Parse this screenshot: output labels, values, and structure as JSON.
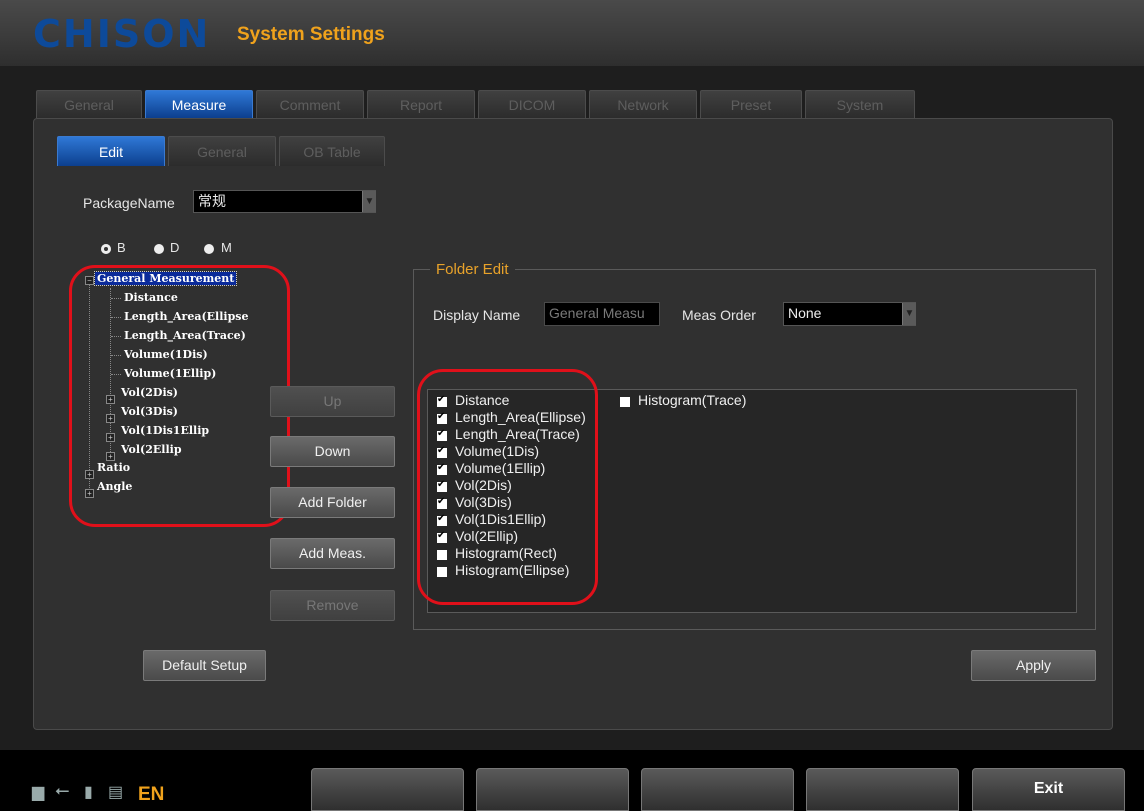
{
  "header": {
    "logo": "CHISON",
    "title": "System Settings"
  },
  "main_tabs": [
    {
      "label": "General",
      "active": false
    },
    {
      "label": "Measure",
      "active": true
    },
    {
      "label": "Comment",
      "active": false
    },
    {
      "label": "Report",
      "active": false
    },
    {
      "label": "DICOM",
      "active": false
    },
    {
      "label": "Network",
      "active": false
    },
    {
      "label": "Preset",
      "active": false
    },
    {
      "label": "System",
      "active": false
    }
  ],
  "sub_tabs": [
    {
      "label": "Edit",
      "active": true
    },
    {
      "label": "General",
      "active": false
    },
    {
      "label": "OB Table",
      "active": false
    }
  ],
  "package": {
    "label": "PackageName",
    "value": "常规"
  },
  "modes": [
    {
      "label": "B",
      "selected": true
    },
    {
      "label": "D",
      "selected": false
    },
    {
      "label": "M",
      "selected": false
    }
  ],
  "tree": {
    "root": "General Measurement",
    "children": [
      "Distance",
      "Length_Area(Ellipse",
      "Length_Area(Trace)",
      "Volume(1Dis)",
      "Volume(1Ellip)"
    ],
    "folders": [
      "Vol(2Dis)",
      "Vol(3Dis)",
      "Vol(1Dis1Ellip",
      "Vol(2Ellip"
    ],
    "other_roots": [
      "Ratio",
      "Angle"
    ]
  },
  "buttons": {
    "up": "Up",
    "down": "Down",
    "add_folder": "Add Folder",
    "add_meas": "Add Meas.",
    "remove": "Remove",
    "default_setup": "Default Setup",
    "apply": "Apply"
  },
  "folder_edit": {
    "title": "Folder Edit",
    "display_name_label": "Display Name",
    "display_name_value": "General Measu",
    "meas_order_label": "Meas Order",
    "meas_order_value": "None"
  },
  "measurements_col1": [
    {
      "label": "Distance",
      "checked": true
    },
    {
      "label": "Length_Area(Ellipse)",
      "checked": true
    },
    {
      "label": "Length_Area(Trace)",
      "checked": true
    },
    {
      "label": "Volume(1Dis)",
      "checked": true
    },
    {
      "label": "Volume(1Ellip)",
      "checked": true
    },
    {
      "label": "Vol(2Dis)",
      "checked": true
    },
    {
      "label": "Vol(3Dis)",
      "checked": true
    },
    {
      "label": "Vol(1Dis1Ellip)",
      "checked": true
    },
    {
      "label": "Vol(2Ellip)",
      "checked": true
    },
    {
      "label": "Histogram(Rect)",
      "checked": false
    },
    {
      "label": "Histogram(Ellipse)",
      "checked": false
    }
  ],
  "measurements_col2": [
    {
      "label": "Histogram(Trace)",
      "checked": false
    }
  ],
  "status": {
    "lang": "EN"
  },
  "bottom_bar": {
    "exit": "Exit"
  }
}
